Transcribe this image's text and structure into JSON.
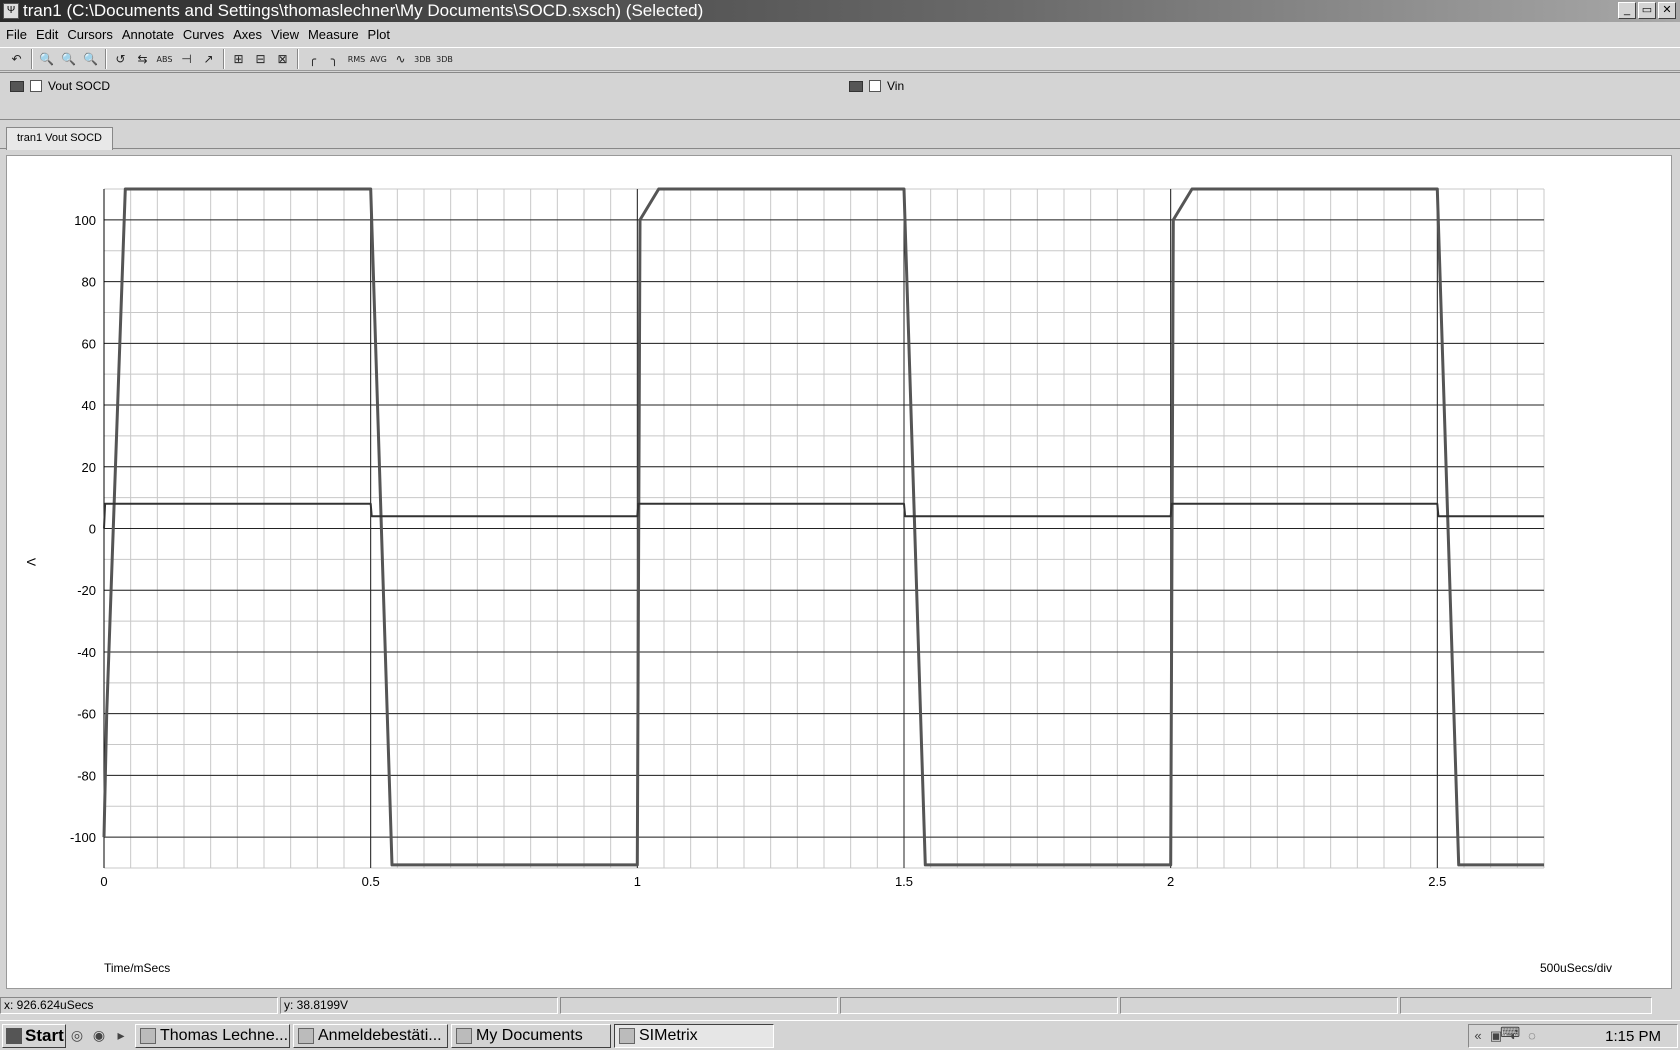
{
  "window": {
    "title": "tran1 (C:\\Documents and Settings\\thomaslechner\\My Documents\\SOCD.sxsch) (Selected)",
    "buttons": [
      "_",
      "▭",
      "✕"
    ]
  },
  "menu": [
    "File",
    "Edit",
    "Cursors",
    "Annotate",
    "Curves",
    "Axes",
    "View",
    "Measure",
    "Plot"
  ],
  "toolbar_icons": [
    "undo-zoom-icon",
    "zoom-box-icon",
    "zoom-in-icon",
    "zoom-out-icon",
    "select-curve-icon",
    "select-all-icon",
    "abs-icon",
    "cursor-icon",
    "cursor-arrow-icon",
    "grid-icon",
    "axis-icon",
    "log-axis-icon",
    "rise-icon",
    "fall-icon",
    "rms-icon",
    "avg-icon",
    "peak-icon",
    "3db-icon",
    "3db-down-icon"
  ],
  "toolbar_labels": [
    "↶",
    "🔍",
    "🔍",
    "🔍",
    "↺",
    "⇆",
    "ABS",
    "⊣",
    "↗",
    "⊞",
    "⊟",
    "⊠",
    "╭",
    "╮",
    "RMS",
    "AVG",
    "∿",
    "3DB",
    "3DB"
  ],
  "legend": [
    {
      "label": "Vout SOCD"
    },
    {
      "label": "Vin"
    }
  ],
  "tab": {
    "label": "tran1 Vout SOCD"
  },
  "plot": {
    "xlabel": "Time/mSecs",
    "ylabel": "V",
    "xscale_label": "500uSecs/div"
  },
  "chart_data": {
    "type": "line",
    "xlabel": "Time/mSecs",
    "ylabel": "V",
    "xlim": [
      0,
      2.7
    ],
    "ylim": [
      -110,
      110
    ],
    "xticks": [
      0,
      0.5,
      1,
      1.5,
      2,
      2.5
    ],
    "xtick_labels": [
      "0",
      "0.5",
      "1",
      "1.5",
      "2",
      "2.5"
    ],
    "yticks": [
      100,
      80,
      60,
      40,
      20,
      0,
      -20,
      -40,
      -60,
      -80,
      -100
    ],
    "grid": true,
    "series": [
      {
        "name": "Vout SOCD",
        "x": [
          0,
          0.005,
          0.04,
          0.5,
          0.54,
          1.0,
          1.005,
          1.04,
          1.5,
          1.54,
          2.0,
          2.005,
          2.04,
          2.5,
          2.54,
          2.7
        ],
        "y": [
          -100,
          -60,
          110,
          110,
          -109,
          -109,
          100,
          110,
          110,
          -109,
          -109,
          100,
          110,
          110,
          -109,
          -109
        ]
      },
      {
        "name": "Vin",
        "x": [
          0,
          0.002,
          0.5,
          0.502,
          1.0,
          1.002,
          1.5,
          1.502,
          2.0,
          2.002,
          2.5,
          2.502,
          2.7
        ],
        "y": [
          0,
          8,
          8,
          4,
          4,
          8,
          8,
          4,
          4,
          8,
          8,
          4,
          4
        ]
      }
    ]
  },
  "status": {
    "x": "x: 926.624uSecs",
    "y": "y: 38.8199V"
  },
  "taskbar": {
    "start": "Start",
    "tasks": [
      {
        "label": "Thomas Lechne...",
        "active": false
      },
      {
        "label": "Anmeldebestäti...",
        "active": false
      },
      {
        "label": "My Documents",
        "active": false
      },
      {
        "label": "SIMetrix",
        "active": true
      }
    ],
    "clock": "1:15 PM"
  }
}
